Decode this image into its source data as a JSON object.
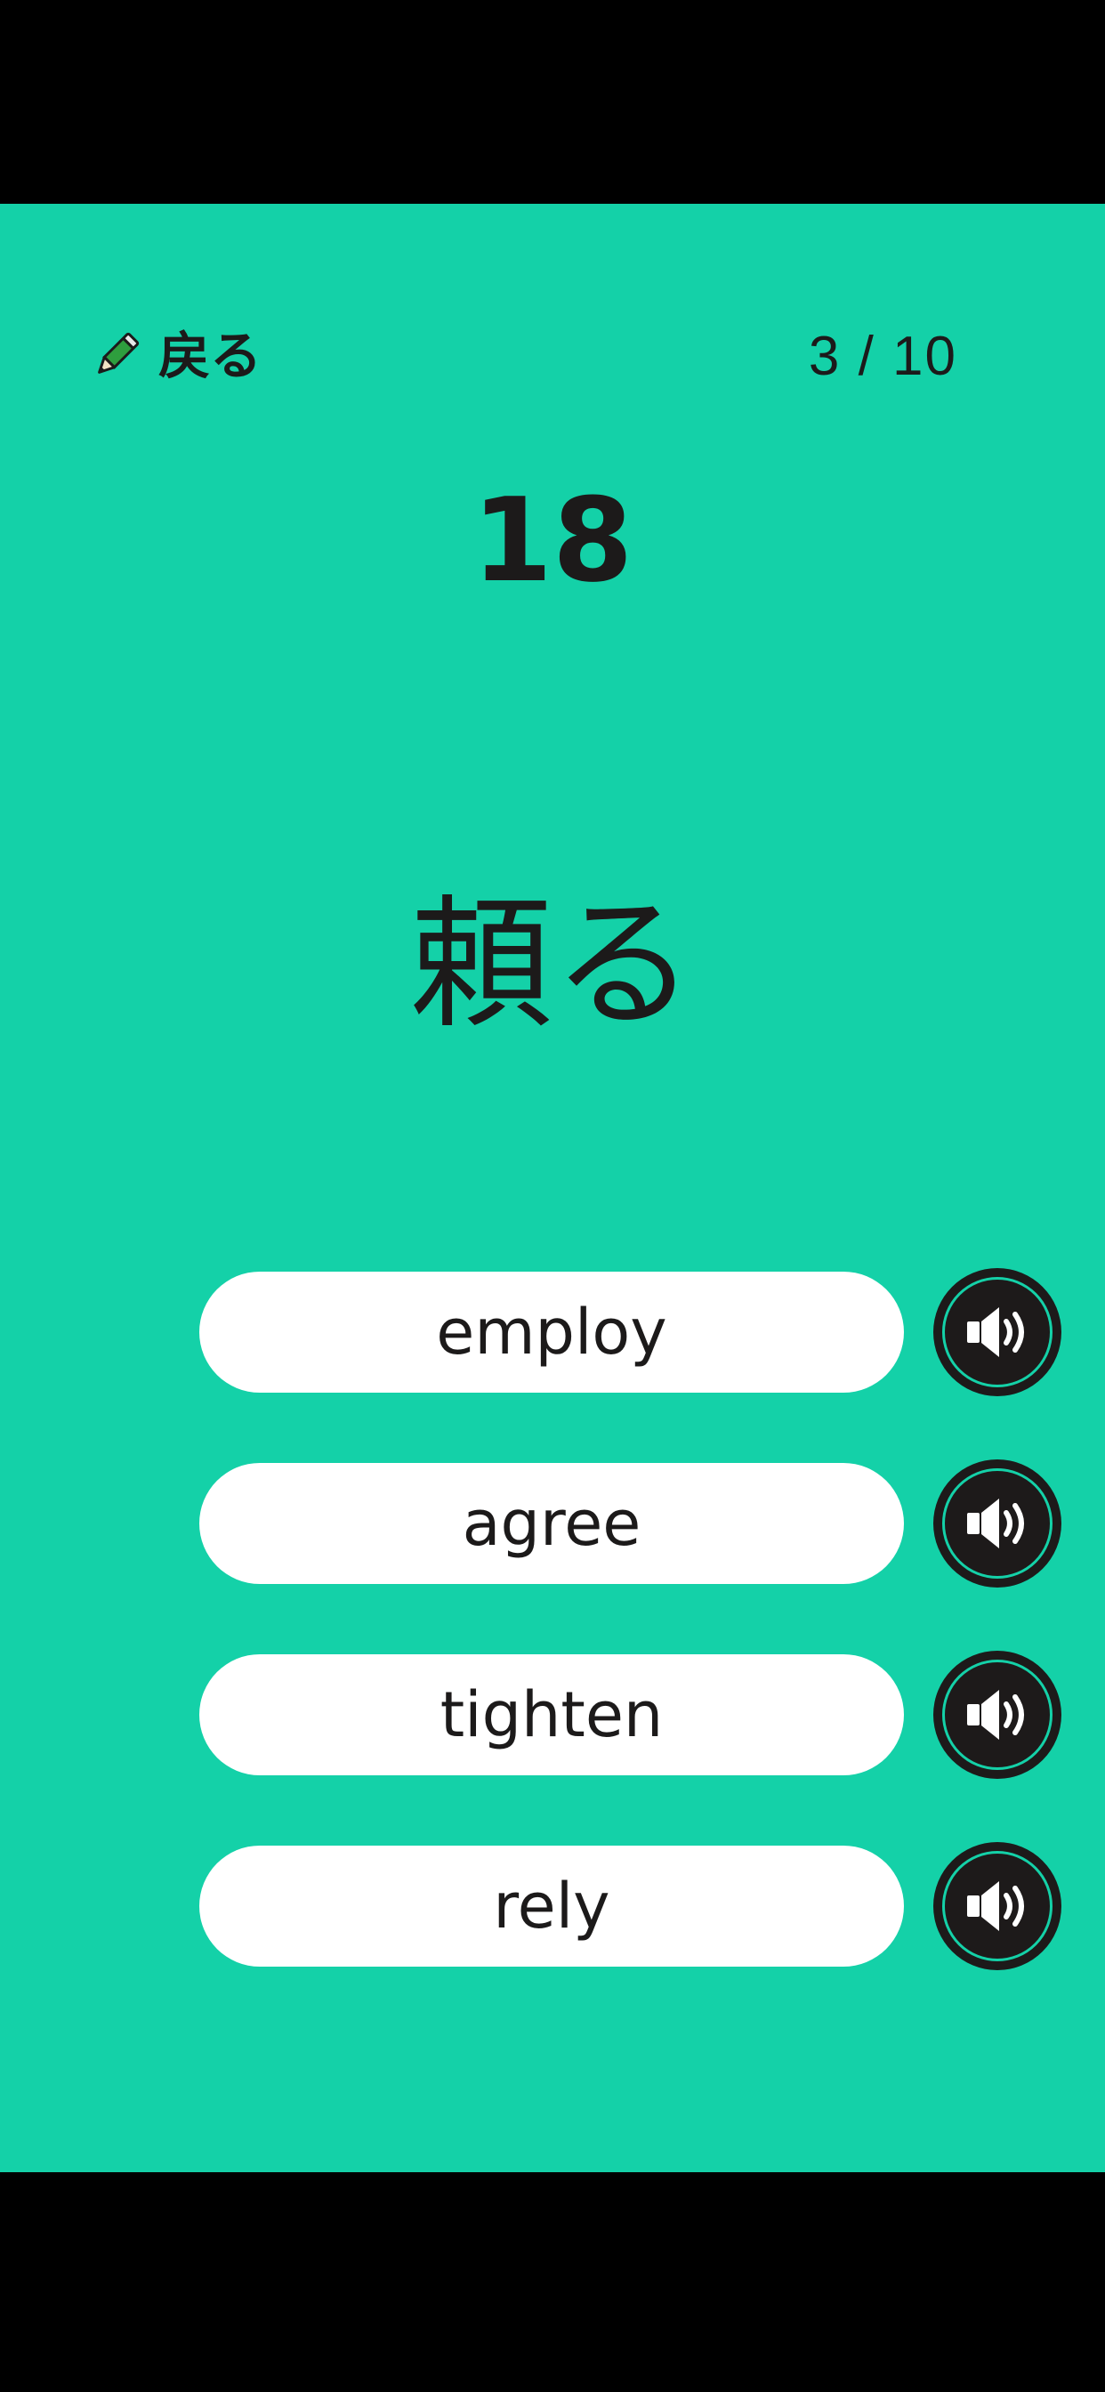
{
  "header": {
    "back_label": "戻る",
    "back_icon": "pencil-icon",
    "progress": "3 / 10"
  },
  "timer": "18",
  "question": "頼る",
  "options": [
    {
      "label": "employ",
      "speaker_icon": "speaker-icon"
    },
    {
      "label": "agree",
      "speaker_icon": "speaker-icon"
    },
    {
      "label": "tighten",
      "speaker_icon": "speaker-icon"
    },
    {
      "label": "rely",
      "speaker_icon": "speaker-icon"
    }
  ],
  "colors": {
    "background": "#14d1a8",
    "text": "#1c1a1a",
    "button": "#ffffff",
    "speaker": "#1d1a1a",
    "pencil": "#2e9e3e"
  }
}
